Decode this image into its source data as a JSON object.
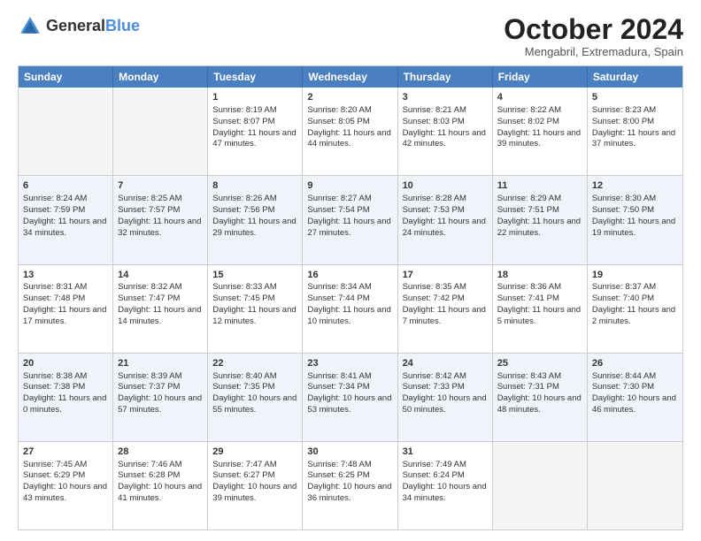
{
  "header": {
    "logo_general": "General",
    "logo_blue": "Blue",
    "title": "October 2024",
    "subtitle": "Mengabril, Extremadura, Spain"
  },
  "weekdays": [
    "Sunday",
    "Monday",
    "Tuesday",
    "Wednesday",
    "Thursday",
    "Friday",
    "Saturday"
  ],
  "weeks": [
    [
      {
        "day": "",
        "empty": true
      },
      {
        "day": "",
        "empty": true
      },
      {
        "day": "1",
        "sunrise": "Sunrise: 8:19 AM",
        "sunset": "Sunset: 8:07 PM",
        "daylight": "Daylight: 11 hours and 47 minutes."
      },
      {
        "day": "2",
        "sunrise": "Sunrise: 8:20 AM",
        "sunset": "Sunset: 8:05 PM",
        "daylight": "Daylight: 11 hours and 44 minutes."
      },
      {
        "day": "3",
        "sunrise": "Sunrise: 8:21 AM",
        "sunset": "Sunset: 8:03 PM",
        "daylight": "Daylight: 11 hours and 42 minutes."
      },
      {
        "day": "4",
        "sunrise": "Sunrise: 8:22 AM",
        "sunset": "Sunset: 8:02 PM",
        "daylight": "Daylight: 11 hours and 39 minutes."
      },
      {
        "day": "5",
        "sunrise": "Sunrise: 8:23 AM",
        "sunset": "Sunset: 8:00 PM",
        "daylight": "Daylight: 11 hours and 37 minutes."
      }
    ],
    [
      {
        "day": "6",
        "sunrise": "Sunrise: 8:24 AM",
        "sunset": "Sunset: 7:59 PM",
        "daylight": "Daylight: 11 hours and 34 minutes."
      },
      {
        "day": "7",
        "sunrise": "Sunrise: 8:25 AM",
        "sunset": "Sunset: 7:57 PM",
        "daylight": "Daylight: 11 hours and 32 minutes."
      },
      {
        "day": "8",
        "sunrise": "Sunrise: 8:26 AM",
        "sunset": "Sunset: 7:56 PM",
        "daylight": "Daylight: 11 hours and 29 minutes."
      },
      {
        "day": "9",
        "sunrise": "Sunrise: 8:27 AM",
        "sunset": "Sunset: 7:54 PM",
        "daylight": "Daylight: 11 hours and 27 minutes."
      },
      {
        "day": "10",
        "sunrise": "Sunrise: 8:28 AM",
        "sunset": "Sunset: 7:53 PM",
        "daylight": "Daylight: 11 hours and 24 minutes."
      },
      {
        "day": "11",
        "sunrise": "Sunrise: 8:29 AM",
        "sunset": "Sunset: 7:51 PM",
        "daylight": "Daylight: 11 hours and 22 minutes."
      },
      {
        "day": "12",
        "sunrise": "Sunrise: 8:30 AM",
        "sunset": "Sunset: 7:50 PM",
        "daylight": "Daylight: 11 hours and 19 minutes."
      }
    ],
    [
      {
        "day": "13",
        "sunrise": "Sunrise: 8:31 AM",
        "sunset": "Sunset: 7:48 PM",
        "daylight": "Daylight: 11 hours and 17 minutes."
      },
      {
        "day": "14",
        "sunrise": "Sunrise: 8:32 AM",
        "sunset": "Sunset: 7:47 PM",
        "daylight": "Daylight: 11 hours and 14 minutes."
      },
      {
        "day": "15",
        "sunrise": "Sunrise: 8:33 AM",
        "sunset": "Sunset: 7:45 PM",
        "daylight": "Daylight: 11 hours and 12 minutes."
      },
      {
        "day": "16",
        "sunrise": "Sunrise: 8:34 AM",
        "sunset": "Sunset: 7:44 PM",
        "daylight": "Daylight: 11 hours and 10 minutes."
      },
      {
        "day": "17",
        "sunrise": "Sunrise: 8:35 AM",
        "sunset": "Sunset: 7:42 PM",
        "daylight": "Daylight: 11 hours and 7 minutes."
      },
      {
        "day": "18",
        "sunrise": "Sunrise: 8:36 AM",
        "sunset": "Sunset: 7:41 PM",
        "daylight": "Daylight: 11 hours and 5 minutes."
      },
      {
        "day": "19",
        "sunrise": "Sunrise: 8:37 AM",
        "sunset": "Sunset: 7:40 PM",
        "daylight": "Daylight: 11 hours and 2 minutes."
      }
    ],
    [
      {
        "day": "20",
        "sunrise": "Sunrise: 8:38 AM",
        "sunset": "Sunset: 7:38 PM",
        "daylight": "Daylight: 11 hours and 0 minutes."
      },
      {
        "day": "21",
        "sunrise": "Sunrise: 8:39 AM",
        "sunset": "Sunset: 7:37 PM",
        "daylight": "Daylight: 10 hours and 57 minutes."
      },
      {
        "day": "22",
        "sunrise": "Sunrise: 8:40 AM",
        "sunset": "Sunset: 7:35 PM",
        "daylight": "Daylight: 10 hours and 55 minutes."
      },
      {
        "day": "23",
        "sunrise": "Sunrise: 8:41 AM",
        "sunset": "Sunset: 7:34 PM",
        "daylight": "Daylight: 10 hours and 53 minutes."
      },
      {
        "day": "24",
        "sunrise": "Sunrise: 8:42 AM",
        "sunset": "Sunset: 7:33 PM",
        "daylight": "Daylight: 10 hours and 50 minutes."
      },
      {
        "day": "25",
        "sunrise": "Sunrise: 8:43 AM",
        "sunset": "Sunset: 7:31 PM",
        "daylight": "Daylight: 10 hours and 48 minutes."
      },
      {
        "day": "26",
        "sunrise": "Sunrise: 8:44 AM",
        "sunset": "Sunset: 7:30 PM",
        "daylight": "Daylight: 10 hours and 46 minutes."
      }
    ],
    [
      {
        "day": "27",
        "sunrise": "Sunrise: 7:45 AM",
        "sunset": "Sunset: 6:29 PM",
        "daylight": "Daylight: 10 hours and 43 minutes."
      },
      {
        "day": "28",
        "sunrise": "Sunrise: 7:46 AM",
        "sunset": "Sunset: 6:28 PM",
        "daylight": "Daylight: 10 hours and 41 minutes."
      },
      {
        "day": "29",
        "sunrise": "Sunrise: 7:47 AM",
        "sunset": "Sunset: 6:27 PM",
        "daylight": "Daylight: 10 hours and 39 minutes."
      },
      {
        "day": "30",
        "sunrise": "Sunrise: 7:48 AM",
        "sunset": "Sunset: 6:25 PM",
        "daylight": "Daylight: 10 hours and 36 minutes."
      },
      {
        "day": "31",
        "sunrise": "Sunrise: 7:49 AM",
        "sunset": "Sunset: 6:24 PM",
        "daylight": "Daylight: 10 hours and 34 minutes."
      },
      {
        "day": "",
        "empty": true
      },
      {
        "day": "",
        "empty": true
      }
    ]
  ]
}
